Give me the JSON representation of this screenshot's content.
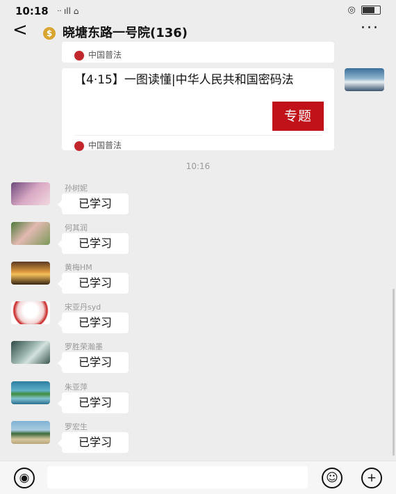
{
  "status": {
    "time": "10:18",
    "signal": "ᐧᐧ ıll ⌂"
  },
  "header": {
    "title": "晓塘东路一号院(136)",
    "back_label": "<",
    "more_label": "···"
  },
  "articles": [
    {
      "source": "中国普法"
    },
    {
      "title": "【4·15】一图读懂|中华人民共和国密码法",
      "thumb_text": "专题",
      "source": "中国普法"
    }
  ],
  "time_separator": "10:16",
  "messages": [
    {
      "name": "孙树妮",
      "text": "已学习"
    },
    {
      "name": "何其润",
      "text": "已学习"
    },
    {
      "name": "黄梅HM",
      "text": "已学习"
    },
    {
      "name": "宋亚丹syd",
      "text": "已学习"
    },
    {
      "name": "罗胜荣瀚墨",
      "text": "已学习"
    },
    {
      "name": "朱亚萍",
      "text": "已学习"
    },
    {
      "name": "罗宏生",
      "text": "已学习"
    }
  ]
}
